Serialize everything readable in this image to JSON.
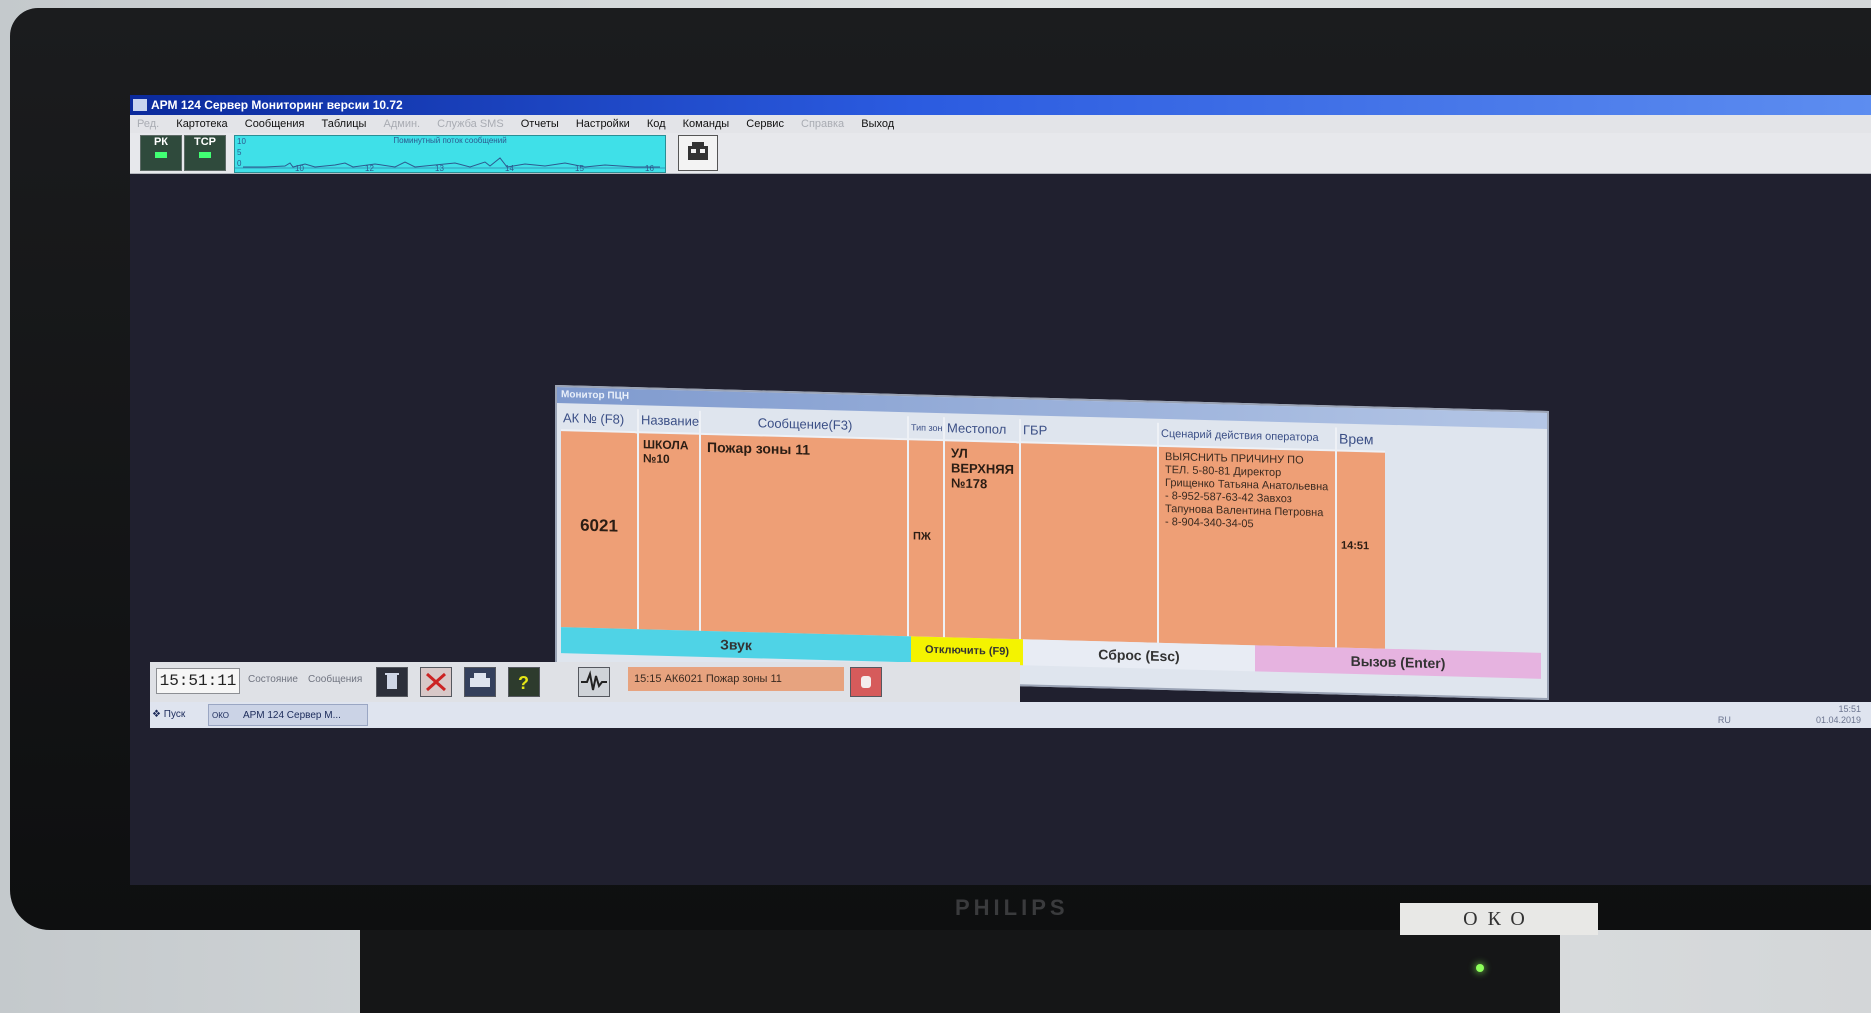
{
  "window": {
    "title": "АРМ 124 Сервер Мониторинг версии 10.72"
  },
  "menu": {
    "items": [
      {
        "label": "Ред.",
        "disabled": true
      },
      {
        "label": "Картотека",
        "disabled": false
      },
      {
        "label": "Сообщения",
        "disabled": false
      },
      {
        "label": "Таблицы",
        "disabled": false
      },
      {
        "label": "Админ.",
        "disabled": true
      },
      {
        "label": "Служба SMS",
        "disabled": true
      },
      {
        "label": "Отчеты",
        "disabled": false
      },
      {
        "label": "Настройки",
        "disabled": false
      },
      {
        "label": "Код",
        "disabled": false
      },
      {
        "label": "Команды",
        "disabled": false
      },
      {
        "label": "Сервис",
        "disabled": false
      },
      {
        "label": "Справка",
        "disabled": true
      },
      {
        "label": "Выход",
        "disabled": false
      }
    ]
  },
  "toolbar": {
    "pk_label": "РК",
    "tcp_label": "ТСР",
    "graph_caption": "Поминутный поток сообщений",
    "graph_y_ticks": [
      "10",
      "5",
      "0"
    ],
    "graph_x_ticks": [
      "10",
      "12",
      "13",
      "14",
      "15",
      "16"
    ]
  },
  "dialog": {
    "title": "Монитор ПЦН",
    "columns": {
      "ak": "АК № (F8)",
      "name": "Название",
      "message": "Сообщение(F3)",
      "zone_type": "Тип зон",
      "location": "Местопол",
      "gbr": "ГБР",
      "scenario": "Сценарий действия оператора",
      "time": "Врем"
    },
    "row": {
      "ak": "6021",
      "name": "ШКОЛА №10",
      "message": "Пожар зоны 11",
      "zone_type": "ПЖ",
      "location": "УЛ ВЕРХНЯЯ №178",
      "gbr": "",
      "scenario": "ВЫЯСНИТЬ ПРИЧИНУ ПО ТЕЛ. 5-80-81 Директор Грищенко Татьяна Анатольевна - 8-952-587-63-42 Завхоз Тапунова Валентина Петровна - 8-904-340-34-05",
      "time": "14:51"
    },
    "buttons": {
      "sound": "Звук",
      "disable": "Отключить (F9)",
      "reset": "Сброс (Esc)",
      "call": "Вызов (Enter)"
    }
  },
  "statusbar": {
    "clock": "15:51:11",
    "tab_state": "Состояние",
    "tab_messages": "Сообщения",
    "last_message": "15:15 АК6021 Пожар зоны 11"
  },
  "taskbar": {
    "start": "Пуск",
    "task_item": "АРМ 124 Сервер М...",
    "task_icon_text": "ОКО",
    "lang": "RU",
    "tray_time": "15:51",
    "tray_date": "01.04.2019"
  },
  "monitor": {
    "brand": "PHILIPS",
    "label": "ОКО"
  },
  "colors": {
    "alarm_row": "#ee9f76",
    "sound_button": "#4fd3e6",
    "disable_button": "#f4f300",
    "call_button": "#e6b3e0",
    "graph_bg": "#3fe0e8"
  }
}
